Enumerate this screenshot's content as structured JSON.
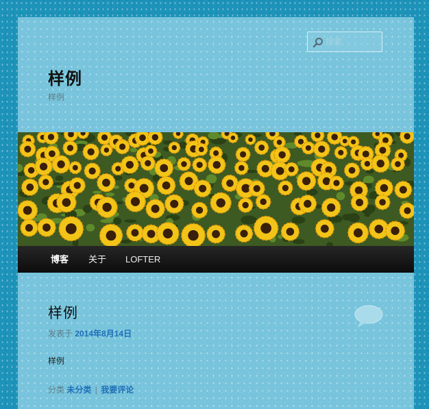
{
  "search": {
    "placeholder": "搜索",
    "icon": "search-icon"
  },
  "site": {
    "title": "样例",
    "description": "样例"
  },
  "banner": {
    "alt": "sunflower-field-image"
  },
  "nav": {
    "items": [
      {
        "label": "博客",
        "current": true
      },
      {
        "label": "关于",
        "current": false
      },
      {
        "label": "LOFTER",
        "current": false
      }
    ]
  },
  "post": {
    "title": "样例",
    "meta_prefix": "发表于",
    "date": "2014年8月14日",
    "body": "样例",
    "category_prefix": "分类",
    "category": "未分类",
    "separator": "|",
    "comment_link": "我要评论"
  },
  "colors": {
    "background": "#1d93b9",
    "page": "#78c4dc",
    "link": "#1f6fb8",
    "nav_bar": "#111111"
  }
}
